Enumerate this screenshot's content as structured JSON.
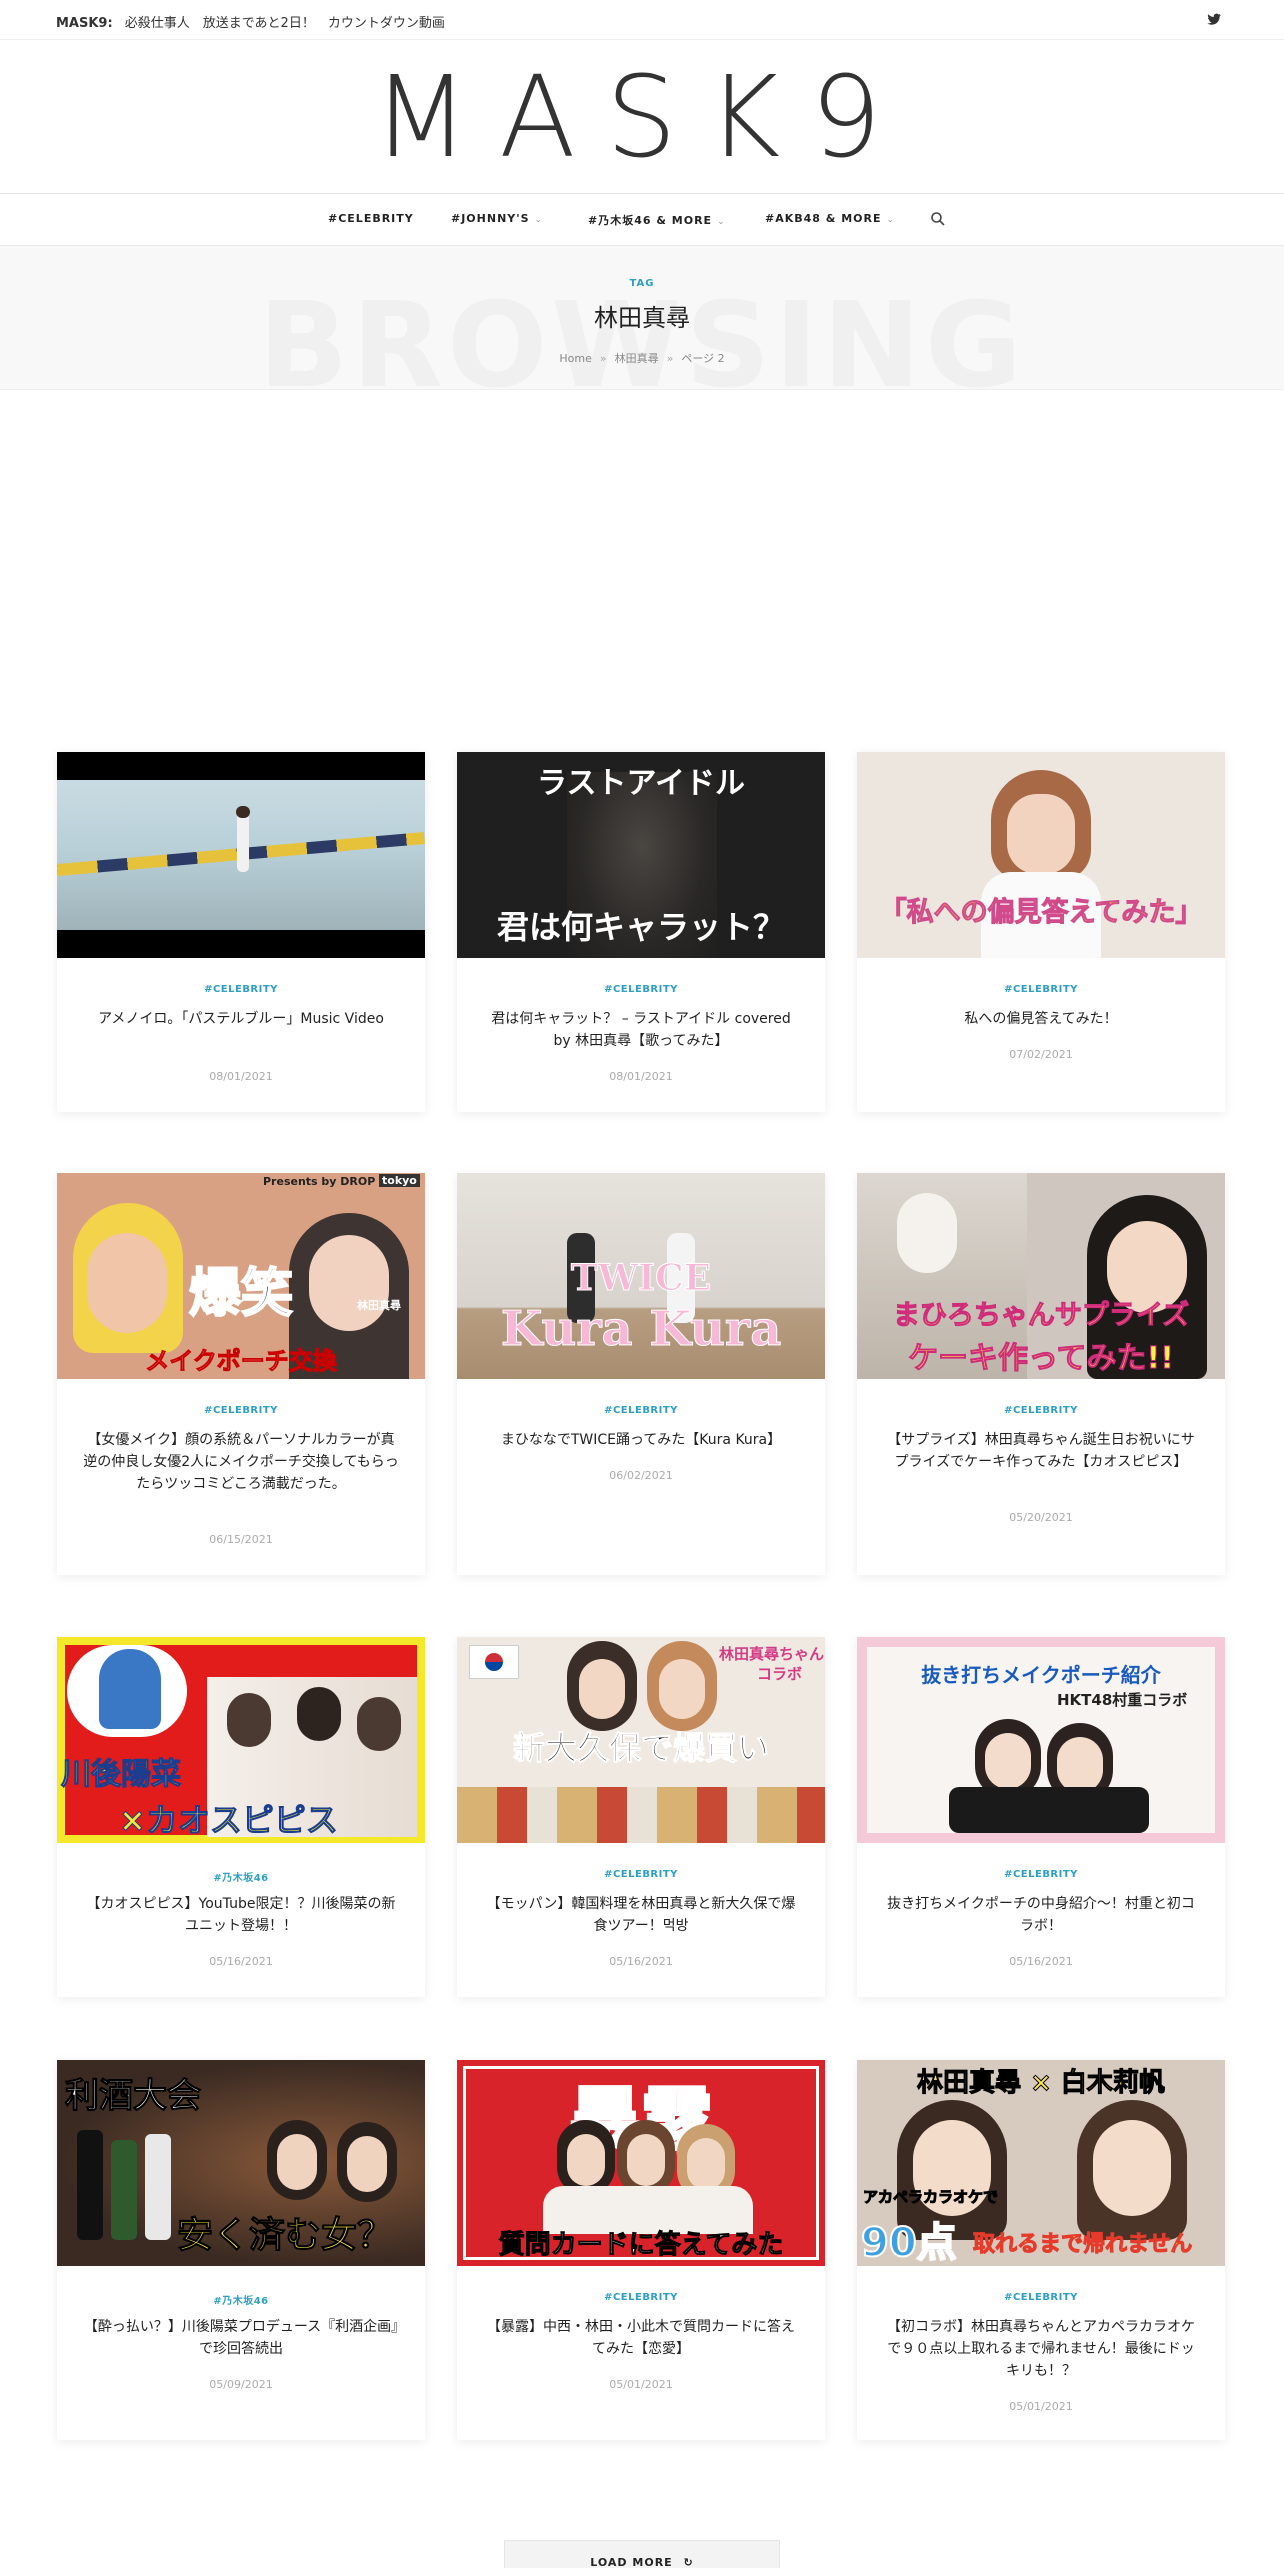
{
  "topbar": {
    "label": "MASK9:",
    "headline": "必殺仕事人　放送まであと2日！　カウントダウン動画",
    "social_icon": "twitter-icon"
  },
  "logo": {
    "text": "MASK9"
  },
  "nav": {
    "items": [
      {
        "label": "#CELEBRITY"
      },
      {
        "label": "#JOHNNY'S"
      },
      {
        "label": "#乃木坂46 & MORE"
      },
      {
        "label": "#AKB48 & MORE"
      }
    ],
    "search_icon": "search-icon"
  },
  "browse": {
    "ghost": "BROWSING",
    "tag": "TAG",
    "title": "林田真尋",
    "breadcrumb": [
      "Home",
      "林田真尋",
      "ページ 2"
    ]
  },
  "posts": [
    {
      "category": "#CELEBRITY",
      "title": "アメノイロ。「パステルブルー」Music Video",
      "date": "08/01/2021"
    },
    {
      "category": "#CELEBRITY",
      "title": "君は何キャラット？ – ラストアイドル covered by 林田真尋【歌ってみた】",
      "date": "08/01/2021",
      "thumb_text": [
        "ラストアイドル",
        "君は何キャラット？"
      ]
    },
    {
      "category": "#CELEBRITY",
      "title": "私への偏見答えてみた！",
      "date": "07/02/2021",
      "thumb_text": [
        "「私への偏見答えてみた」"
      ]
    },
    {
      "category": "#CELEBRITY",
      "title": "【女優メイク】顔の系統＆パーソナルカラーが真逆の仲良し女優2人にメイクポーチ交換してもらったらツッコミどころ満載だった。",
      "date": "06/15/2021",
      "thumb_text": [
        "Presents by DROP",
        "tokyo",
        "爆笑",
        "メイクポーチ交換",
        "林田真尋"
      ]
    },
    {
      "category": "#CELEBRITY",
      "title": "まひななでTWICE踊ってみた【Kura Kura】",
      "date": "06/02/2021",
      "thumb_text": [
        "TWICE",
        "Kura Kura"
      ]
    },
    {
      "category": "#CELEBRITY",
      "title": "【サプライズ】林田真尋ちゃん誕生日お祝いにサプライズでケーキ作ってみた【カオスピピス】",
      "date": "05/20/2021",
      "thumb_text": [
        "まひろちゃんサプライズ",
        "ケーキ作ってみた!!"
      ]
    },
    {
      "category": "#乃木坂46",
      "title": "【カオスピピス】YouTube限定！？川後陽菜の新ユニット登場！！",
      "date": "05/16/2021",
      "thumb_text": [
        "川後陽菜",
        "×カオスピピス"
      ]
    },
    {
      "category": "#CELEBRITY",
      "title": "【モッパン】韓国料理を林田真尋と新大久保で爆食ツアー！먹방",
      "date": "05/16/2021",
      "thumb_text": [
        "林田真尋ちゃん",
        "コラボ",
        "新大久保で爆買い"
      ]
    },
    {
      "category": "#CELEBRITY",
      "title": "抜き打ちメイクポーチの中身紹介〜！村重と初コラボ！",
      "date": "05/16/2021",
      "thumb_text": [
        "抜き打ちメイクポーチ紹介",
        "HKT48村重コラボ"
      ]
    },
    {
      "category": "#乃木坂46",
      "title": "【酔っ払い？】川後陽菜プロデュース『利酒企画』で珍回答続出",
      "date": "05/09/2021",
      "thumb_text": [
        "利酒大会",
        "安く済む女？"
      ]
    },
    {
      "category": "#CELEBRITY",
      "title": "【暴露】中西・林田・小此木で質問カードに答えてみた【恋愛】",
      "date": "05/01/2021",
      "thumb_text": [
        "暴露",
        "質問カードに答えてみた"
      ]
    },
    {
      "category": "#CELEBRITY",
      "title": "【初コラボ】林田真尋ちゃんとアカペラカラオケで９０点以上取れるまで帰れません！最後にドッキリも！？",
      "date": "05/01/2021",
      "thumb_text": [
        "林田真尋 × 白木莉帆",
        "アカペラカラオケで",
        "90点",
        "取れるまで帰れません"
      ]
    }
  ],
  "load_more": {
    "label": "LOAD MORE"
  },
  "colors": {
    "accent": "#2e9fc1",
    "text": "#222222",
    "muted": "#aaaaaa"
  }
}
